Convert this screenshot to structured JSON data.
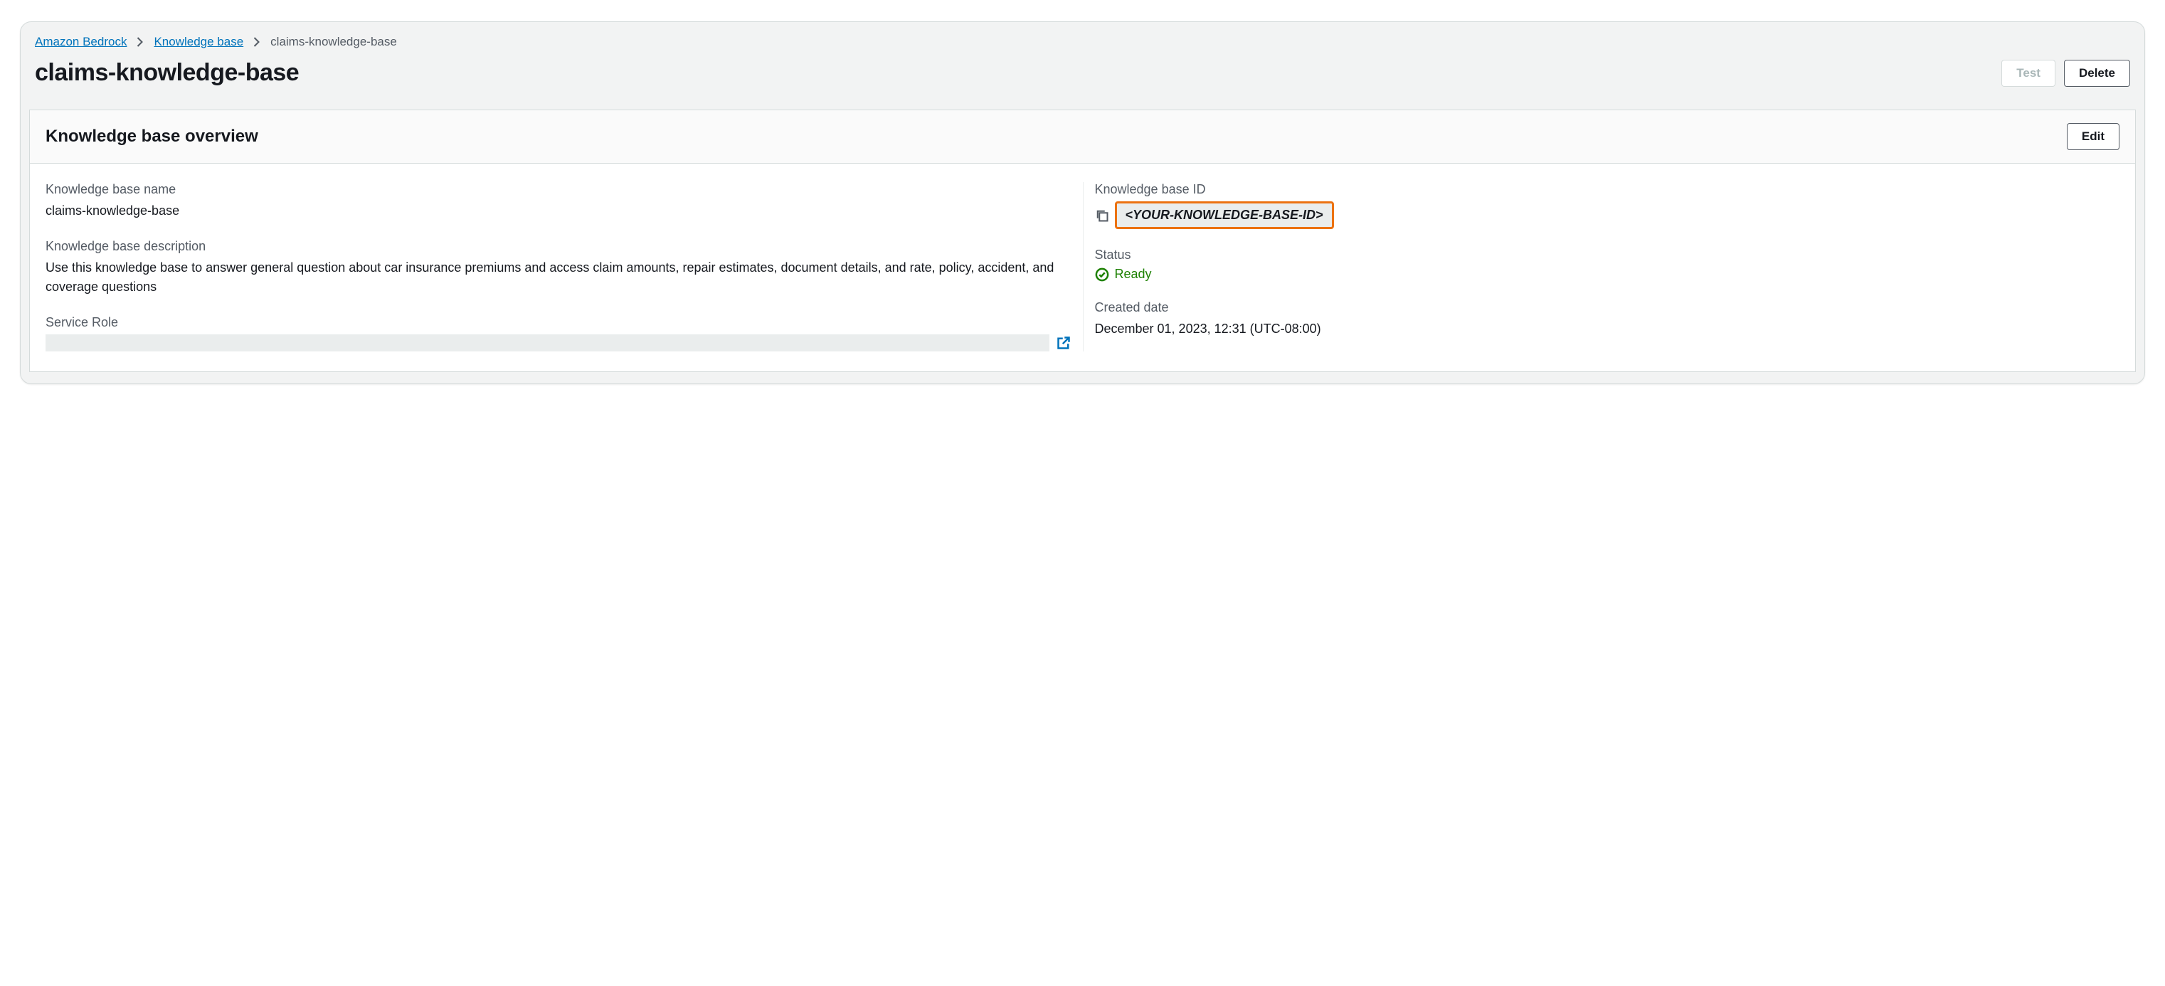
{
  "breadcrumbs": {
    "item0": "Amazon Bedrock",
    "item1": "Knowledge base",
    "item2": "claims-knowledge-base"
  },
  "header": {
    "title": "claims-knowledge-base",
    "test_label": "Test",
    "delete_label": "Delete"
  },
  "overview": {
    "section_title": "Knowledge base overview",
    "edit_label": "Edit",
    "name_label": "Knowledge base name",
    "name_value": "claims-knowledge-base",
    "description_label": "Knowledge base description",
    "description_value": "Use this knowledge base to answer general question about car insurance premiums and access claim amounts, repair estimates, document details, and rate, policy, accident, and coverage questions",
    "service_role_label": "Service Role",
    "kb_id_label": "Knowledge base ID",
    "kb_id_value": "<YOUR-KNOWLEDGE-BASE-ID>",
    "status_label": "Status",
    "status_value": "Ready",
    "created_label": "Created date",
    "created_value": "December 01, 2023, 12:31 (UTC-08:00)"
  }
}
